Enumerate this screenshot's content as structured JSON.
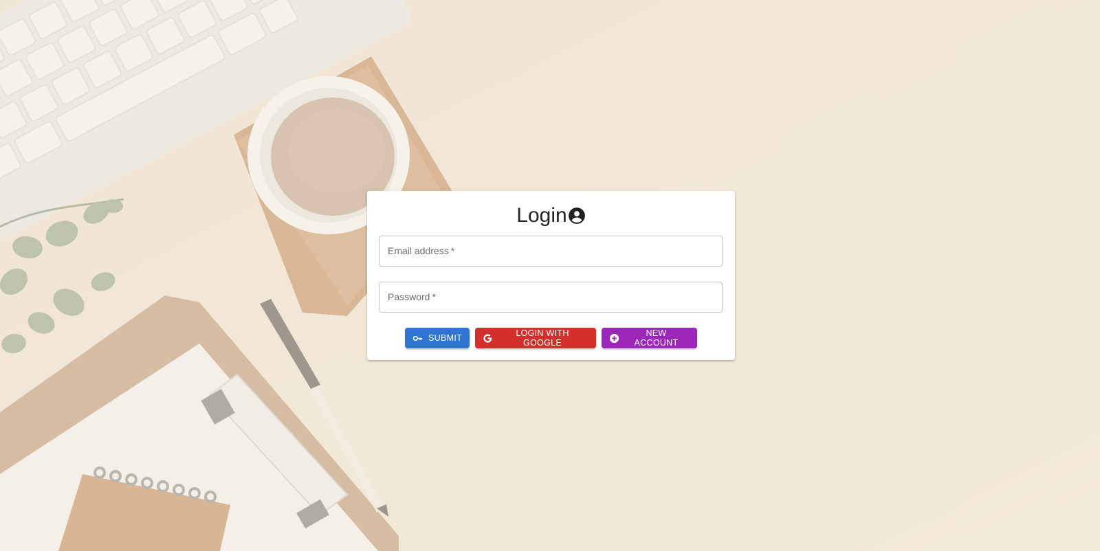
{
  "colors": {
    "background": "#f1e6d7",
    "card": "#ffffff",
    "submit": "#2f74d0",
    "google": "#d3302d",
    "new_account": "#9c27b8",
    "title_text": "#222222"
  },
  "login_card": {
    "title": "Login",
    "title_icon": "account-circle-icon",
    "email": {
      "label": "Email address",
      "required_marker": "*",
      "value": ""
    },
    "password": {
      "label": "Password",
      "required_marker": "*",
      "value": ""
    },
    "buttons": {
      "submit": {
        "label": "Submit",
        "icon": "key-icon"
      },
      "google": {
        "label": "Login with Google",
        "icon": "google-icon"
      },
      "new_account": {
        "label": "New Account",
        "icon": "add-circle-icon"
      }
    }
  }
}
